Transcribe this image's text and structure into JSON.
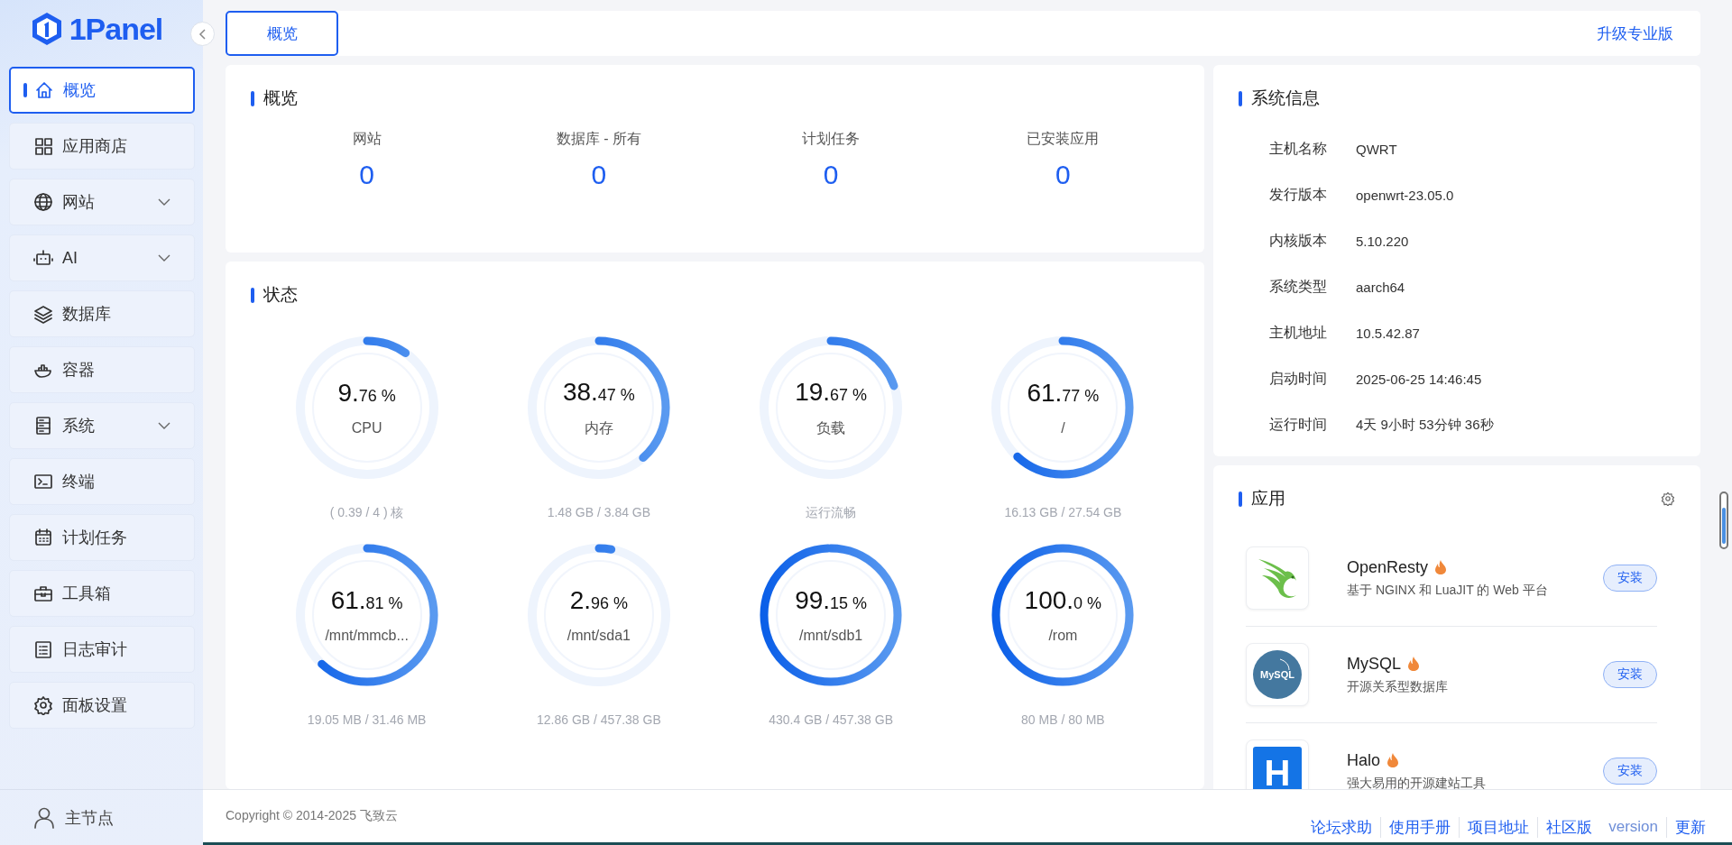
{
  "brand": "1Panel",
  "sidebar": {
    "items": [
      {
        "label": "概览",
        "selected": true,
        "expandable": false
      },
      {
        "label": "应用商店",
        "selected": false,
        "expandable": false
      },
      {
        "label": "网站",
        "selected": false,
        "expandable": true
      },
      {
        "label": "AI",
        "selected": false,
        "expandable": true
      },
      {
        "label": "数据库",
        "selected": false,
        "expandable": false
      },
      {
        "label": "容器",
        "selected": false,
        "expandable": false
      },
      {
        "label": "系统",
        "selected": false,
        "expandable": true
      },
      {
        "label": "终端",
        "selected": false,
        "expandable": false
      },
      {
        "label": "计划任务",
        "selected": false,
        "expandable": false
      },
      {
        "label": "工具箱",
        "selected": false,
        "expandable": false
      },
      {
        "label": "日志审计",
        "selected": false,
        "expandable": false
      },
      {
        "label": "面板设置",
        "selected": false,
        "expandable": false
      }
    ],
    "node": "主节点"
  },
  "tabs": [
    {
      "label": "概览",
      "selected": true
    }
  ],
  "upgrade_link": "升级专业版",
  "overview": {
    "title": "概览",
    "stats": [
      {
        "label": "网站",
        "value": "0"
      },
      {
        "label": "数据库 - 所有",
        "value": "0"
      },
      {
        "label": "计划任务",
        "value": "0"
      },
      {
        "label": "已安装应用",
        "value": "0"
      }
    ]
  },
  "status": {
    "title": "状态",
    "gauges": [
      {
        "value_int": "9.",
        "value_frac": "76 %",
        "label": "CPU",
        "detail": "( 0.39 / 4 ) 核",
        "level": 0.0976
      },
      {
        "value_int": "38.",
        "value_frac": "47 %",
        "label": "内存",
        "detail": "1.48 GB / 3.84 GB",
        "level": 0.3847
      },
      {
        "value_int": "19.",
        "value_frac": "67 %",
        "label": "负载",
        "detail": "运行流畅",
        "level": 0.1967
      },
      {
        "value_int": "61.",
        "value_frac": "77 %",
        "label": "/",
        "detail": "16.13 GB / 27.54 GB",
        "level": 0.6177
      },
      {
        "value_int": "61.",
        "value_frac": "81 %",
        "label": "/mnt/mmcb...",
        "detail": "19.05 MB / 31.46 MB",
        "level": 0.6181
      },
      {
        "value_int": "2.",
        "value_frac": "96 %",
        "label": "/mnt/sda1",
        "detail": "12.86 GB / 457.38 GB",
        "level": 0.0296
      },
      {
        "value_int": "99.",
        "value_frac": "15 %",
        "label": "/mnt/sdb1",
        "detail": "430.4 GB / 457.38 GB",
        "level": 0.9915
      },
      {
        "value_int": "100.",
        "value_frac": "0 %",
        "label": "/rom",
        "detail": "80 MB / 80 MB",
        "level": 1.0
      }
    ]
  },
  "system_info": {
    "title": "系统信息",
    "rows": [
      {
        "label": "主机名称",
        "value": "QWRT"
      },
      {
        "label": "发行版本",
        "value": "openwrt-23.05.0"
      },
      {
        "label": "内核版本",
        "value": "5.10.220"
      },
      {
        "label": "系统类型",
        "value": "aarch64"
      },
      {
        "label": "主机地址",
        "value": "10.5.42.87"
      },
      {
        "label": "启动时间",
        "value": "2025-06-25 14:46:45"
      },
      {
        "label": "运行时间",
        "value": "4天 9小时 53分钟 36秒"
      }
    ]
  },
  "apps": {
    "title": "应用",
    "items": [
      {
        "name": "OpenResty",
        "hot": true,
        "description": "基于 NGINX 和 LuaJIT 的 Web 平台",
        "button": "安装",
        "kind": "bird"
      },
      {
        "name": "MySQL",
        "hot": true,
        "description": "开源关系型数据库",
        "button": "安装",
        "kind": "circle",
        "logo_text": "MySQL"
      },
      {
        "name": "Halo",
        "hot": true,
        "description": "强大易用的开源建站工具",
        "button": "安装",
        "kind": "square",
        "logo_text": "H"
      }
    ]
  },
  "footer": {
    "copyright": "Copyright © 2014-2025 飞致云",
    "links": [
      {
        "label": "论坛求助",
        "kind": "link"
      },
      {
        "label": "使用手册",
        "kind": "link"
      },
      {
        "label": "项目地址",
        "kind": "link"
      },
      {
        "label": "社区版",
        "kind": "link"
      },
      {
        "label": "version",
        "kind": "version"
      },
      {
        "label": "更新",
        "kind": "link"
      }
    ]
  }
}
